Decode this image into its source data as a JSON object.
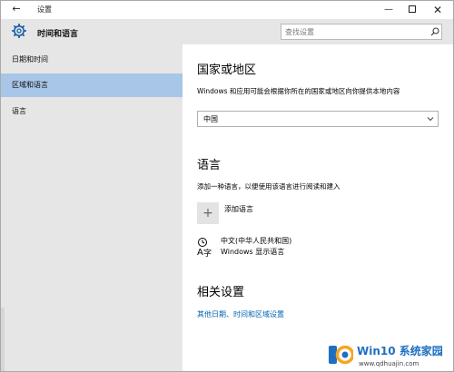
{
  "window": {
    "title": "设置",
    "back_icon": "back-arrow-icon",
    "minimize_icon": "minimize-icon",
    "maximize_icon": "maximize-icon",
    "close_icon": "close-icon"
  },
  "header": {
    "icon": "gear-icon",
    "title": "时间和语言",
    "search_placeholder": "查找设置",
    "search_icon": "search-icon"
  },
  "sidebar": {
    "items": [
      {
        "label": "日期和时间",
        "active": false
      },
      {
        "label": "区域和语言",
        "active": true
      },
      {
        "label": "语言",
        "active": false
      }
    ]
  },
  "main": {
    "region": {
      "heading": "国家或地区",
      "description": "Windows 和应用可能会根据你所在的国家或地区向你提供本地内容",
      "selected": "中国"
    },
    "language": {
      "heading": "语言",
      "description": "添加一种语言，以便使用该语言进行阅读和建入",
      "add_label": "添加语言",
      "add_icon": "plus-icon",
      "entries": [
        {
          "name": "中文(中华人民共和国)",
          "subtitle": "Windows 显示语言",
          "icon": "language-icon"
        }
      ]
    },
    "related": {
      "heading": "相关设置",
      "link": "其他日期、时间和区域设置"
    }
  },
  "watermark": {
    "brand": "Win10 系统家园",
    "url": "www.qdhuajin.com"
  },
  "colors": {
    "sidebar_bg": "#e6e6e6",
    "active_item": "#a8c6e8",
    "link": "#0063b1"
  }
}
